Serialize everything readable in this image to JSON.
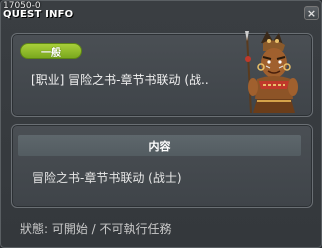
{
  "window": {
    "quest_id": "17050-0",
    "title": "QUEST INFO",
    "close_label": "×"
  },
  "quest": {
    "category_badge": "一般",
    "title": "[职业] 冒险之书-章节书联动 (战..",
    "npc_icon": "tribal-warrior-npc"
  },
  "content": {
    "header": "内容",
    "text": "冒险之书-章节书联动 (战士)"
  },
  "status": {
    "text": "狀態: 可開始 / 不可執行任務"
  },
  "colors": {
    "badge_green": "#8dbb2a",
    "panel_bg": "#454a4f",
    "header_bg": "#59626a"
  }
}
